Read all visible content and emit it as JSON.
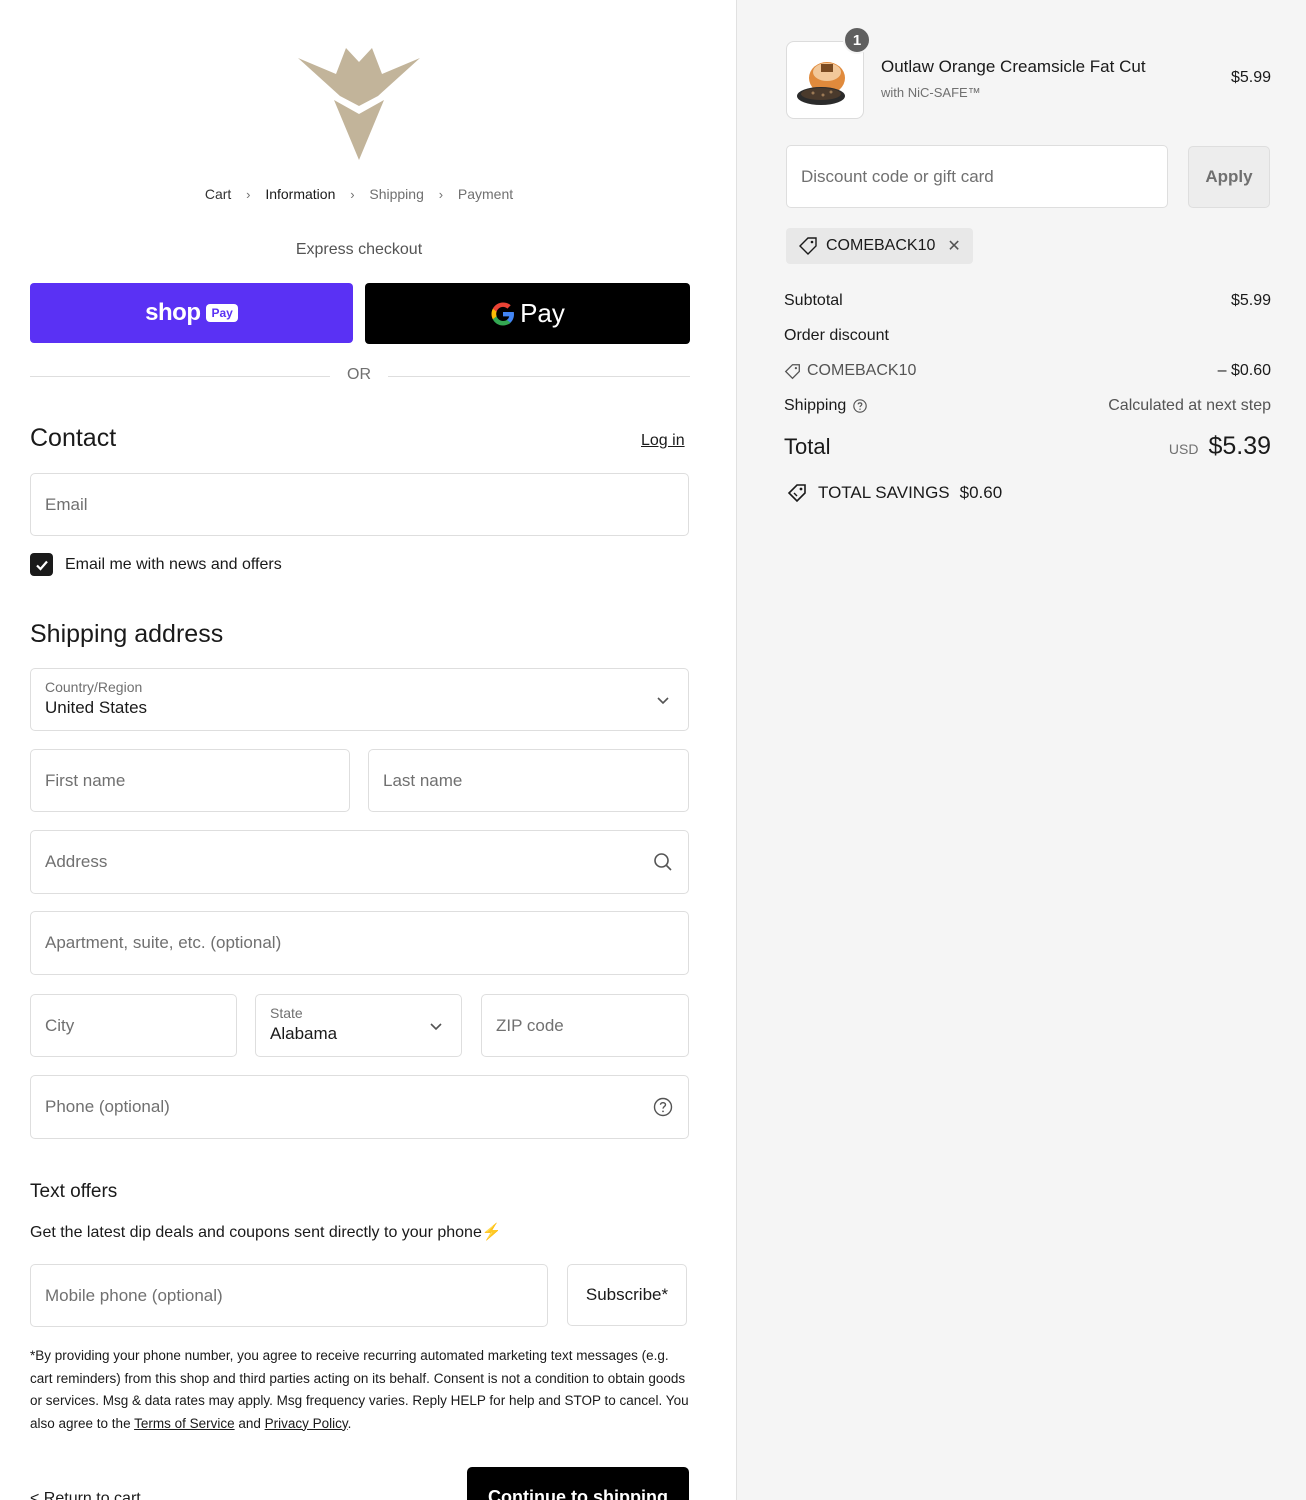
{
  "breadcrumb": {
    "cart": "Cart",
    "information": "Information",
    "shipping": "Shipping",
    "payment": "Payment"
  },
  "express": {
    "title": "Express checkout",
    "shop_word": "shop",
    "shop_badge": "Pay",
    "gpay_g": "G",
    "gpay_pay": "Pay",
    "or": "OR"
  },
  "contact": {
    "title": "Contact",
    "login": "Log in",
    "email_placeholder": "Email",
    "newsletter_label": "Email me with news and offers",
    "newsletter_checked": true
  },
  "shipping": {
    "title": "Shipping address",
    "country_label": "Country/Region",
    "country_value": "United States",
    "first_name": "First name",
    "last_name": "Last name",
    "address": "Address",
    "apartment": "Apartment, suite, etc. (optional)",
    "city": "City",
    "state_label": "State",
    "state_value": "Alabama",
    "zip": "ZIP code",
    "phone": "Phone (optional)"
  },
  "text_offers": {
    "title": "Text offers",
    "description": "Get the latest dip deals and coupons sent directly to your phone⚡",
    "mobile_placeholder": "Mobile phone (optional)",
    "subscribe": "Subscribe*",
    "disclaimer_text": "*By providing your phone number, you agree to receive recurring automated marketing text messages (e.g. cart reminders) from this shop and third parties acting on its behalf. Consent is not a condition to obtain goods or services. Msg & data rates may apply. Msg frequency varies. Reply HELP for help and STOP to cancel. You also agree to the ",
    "terms": "Terms of Service",
    "and": " and ",
    "privacy": "Privacy Policy",
    "end": "."
  },
  "footer": {
    "return": "< Return to cart",
    "continue": "Continue to shipping"
  },
  "order": {
    "quantity": "1",
    "product_title": "Outlaw Orange Creamsicle Fat Cut",
    "product_subtitle": "with NiC-SAFE™",
    "product_price": "$5.99",
    "discount_placeholder": "Discount code or gift card",
    "apply": "Apply",
    "coupon_code": "COMEBACK10",
    "subtotal_label": "Subtotal",
    "subtotal_value": "$5.99",
    "order_discount_label": "Order discount",
    "discount_code": "COMEBACK10",
    "discount_value": "– $0.60",
    "shipping_label": "Shipping",
    "shipping_value": "Calculated at next step",
    "total_label": "Total",
    "currency": "USD",
    "total_value": "$5.39",
    "savings_label": "TOTAL SAVINGS",
    "savings_value": "$0.60"
  },
  "colors": {
    "shop_pay": "#5a31f4",
    "gpay": "#000000",
    "sidebar_bg": "#f5f5f5"
  }
}
